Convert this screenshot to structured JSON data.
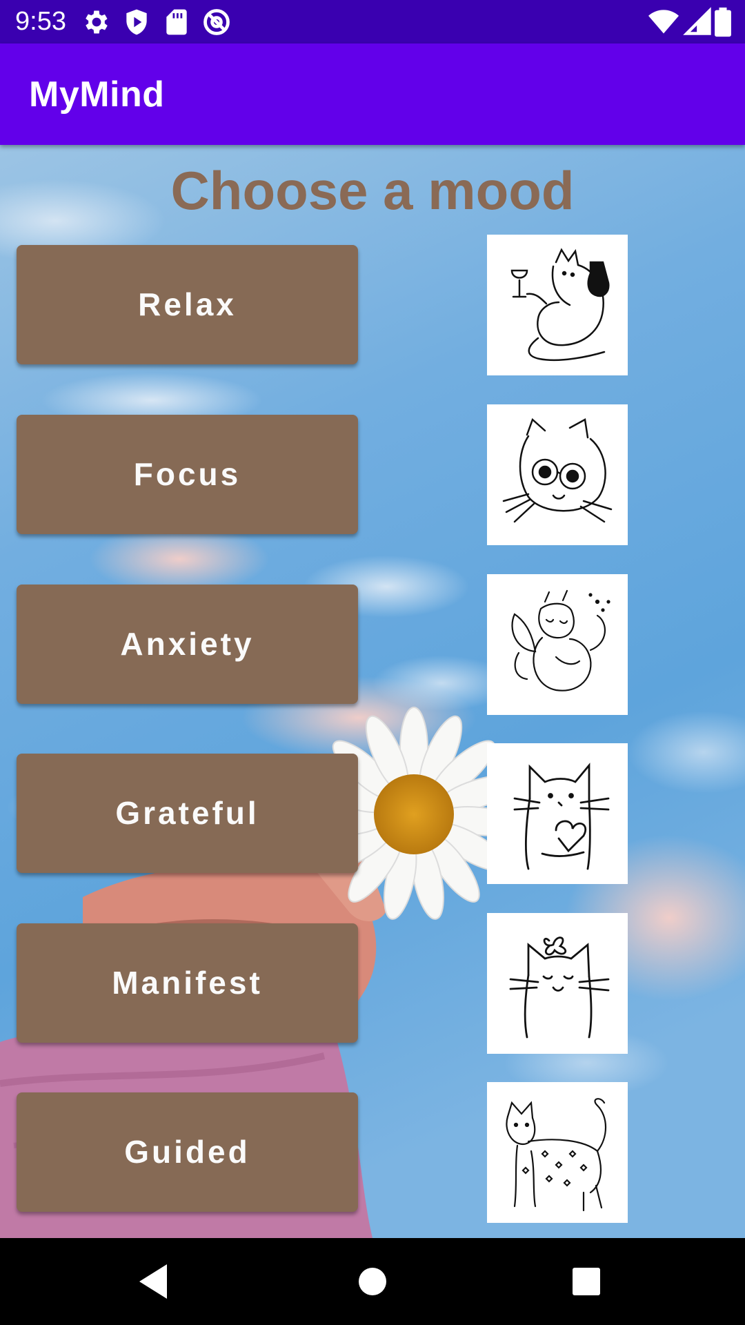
{
  "status_bar": {
    "time": "9:53",
    "left_icons": [
      "gear-icon",
      "play-protect-icon",
      "sd-card-icon",
      "at-sign-icon"
    ],
    "right_icons": [
      "wifi-icon",
      "cell-signal-icon",
      "battery-icon"
    ]
  },
  "app_bar": {
    "title": "MyMind",
    "color": "#6200ea"
  },
  "main": {
    "heading": "Choose a mood",
    "heading_color": "#8a6a55",
    "button_color": "#866a55",
    "moods": [
      {
        "label": "Relax",
        "image": "cat-with-wine-drawing"
      },
      {
        "label": "Focus",
        "image": "cat-with-sunglasses-drawing"
      },
      {
        "label": "Anxiety",
        "image": "fairy-cat-drawing"
      },
      {
        "label": "Grateful",
        "image": "cat-holding-heart-drawing"
      },
      {
        "label": "Manifest",
        "image": "cat-with-bow-drawing"
      },
      {
        "label": "Guided",
        "image": "cat-with-hearts-drawing"
      }
    ]
  },
  "nav_bar": {
    "buttons": [
      "back-icon",
      "home-icon",
      "recents-icon"
    ]
  }
}
